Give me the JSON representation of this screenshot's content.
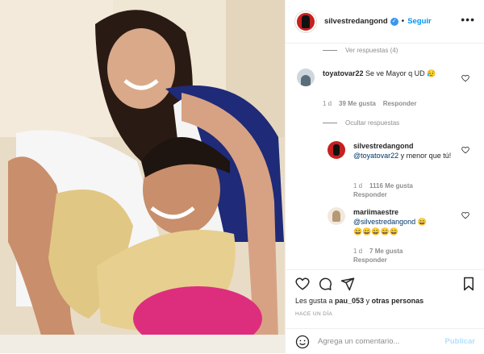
{
  "header": {
    "username": "silvestredangond",
    "verified_glyph": "✓",
    "separator": "•",
    "follow_label": "Seguir",
    "more_icon": "more-options-icon"
  },
  "comments": {
    "view_replies_label": "Ver respuestas (4)",
    "hide_replies_label": "Ocultar respuestas",
    "items": [
      {
        "user": "toyatovar22",
        "text": "Se ve Mayor q UD 😥",
        "time": "1 d",
        "likes": "39 Me gusta",
        "reply": "Responder"
      },
      {
        "user": "silvestredangond",
        "mention": "@toyatovar22",
        "text": " y menor que tú!",
        "time": "1 d",
        "likes": "1116 Me gusta",
        "reply": "Responder"
      },
      {
        "user": "mariimaestre",
        "mention": "@silvestredangond",
        "text": " 😄",
        "text2": "😄😄😄😄😄",
        "time": "1 d",
        "likes": "7 Me gusta",
        "reply": "Responder"
      }
    ]
  },
  "actions": {
    "likes_prefix": "Les gusta a ",
    "likes_user": "pau_053",
    "likes_mid": " y ",
    "likes_others": "otras personas",
    "time_ago": "HACE UN DÍA"
  },
  "composer": {
    "placeholder": "Agrega un comentario...",
    "publish_label": "Publicar"
  },
  "colors": {
    "accent": "#0095f6",
    "publish_disabled": "#b2dffc",
    "muted": "#8e8e8e",
    "mention": "#00376b"
  }
}
